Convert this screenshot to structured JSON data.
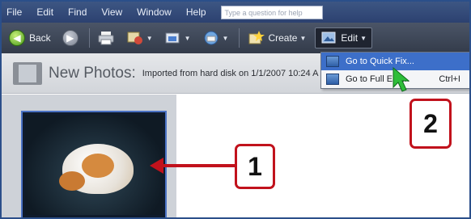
{
  "menubar": {
    "items": [
      {
        "label": "File"
      },
      {
        "label": "Edit"
      },
      {
        "label": "Find"
      },
      {
        "label": "View"
      },
      {
        "label": "Window"
      },
      {
        "label": "Help"
      }
    ],
    "help_search_placeholder": "Type a question for help"
  },
  "toolbar": {
    "back_label": "Back",
    "create_label": "Create",
    "edit_label": "Edit"
  },
  "photos_header": {
    "title": "New Photos:",
    "subtitle": "Imported from hard disk on 1/1/2007 10:24 A"
  },
  "edit_menu": {
    "items": [
      {
        "label": "Go to Quick Fix...",
        "shortcut": ""
      },
      {
        "label": "Go to Full Edit...",
        "shortcut": "Ctrl+I"
      }
    ]
  },
  "callouts": {
    "one": "1",
    "two": "2"
  },
  "colors": {
    "callout_border": "#c1121c",
    "menu_highlight": "#3d6fc9",
    "thumb_border": "#4a72c4"
  }
}
